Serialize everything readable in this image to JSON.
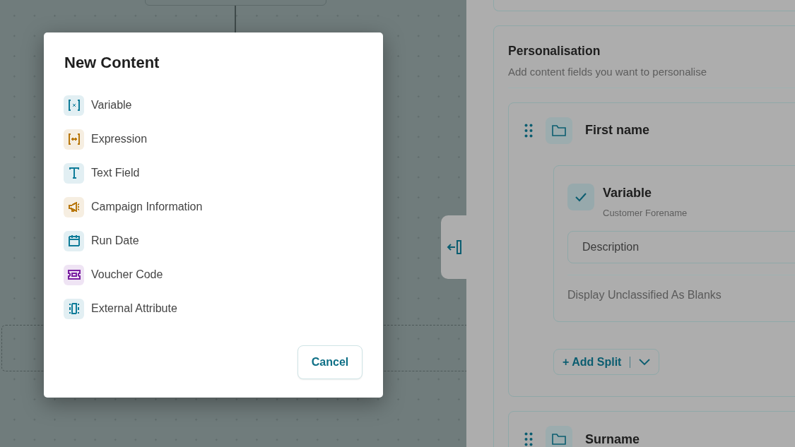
{
  "dialog": {
    "title": "New Content",
    "items": [
      {
        "kind": "variable",
        "label": "Variable",
        "color": "#0e7c99"
      },
      {
        "kind": "expression",
        "label": "Expression",
        "color": "#b8770c"
      },
      {
        "kind": "text",
        "label": "Text Field",
        "color": "#0e7c99"
      },
      {
        "kind": "campaign",
        "label": "Campaign Information",
        "color": "#b8770c"
      },
      {
        "kind": "date",
        "label": "Run Date",
        "color": "#0e7c99"
      },
      {
        "kind": "voucher",
        "label": "Voucher Code",
        "color": "#7a1fa2"
      },
      {
        "kind": "external",
        "label": "External Attribute",
        "color": "#0e7c99"
      }
    ],
    "cancel": "Cancel"
  },
  "panel": {
    "title": "Personalisation",
    "subtitle": "Add content fields you want to personalise",
    "fields": [
      {
        "name": "First name",
        "content": {
          "type": "Variable",
          "source": "Customer Forename",
          "checked": true,
          "description_placeholder": "Description",
          "option": "Display Unclassified As Blanks"
        },
        "add_split": "+ Add Split"
      },
      {
        "name": "Surname"
      }
    ]
  }
}
